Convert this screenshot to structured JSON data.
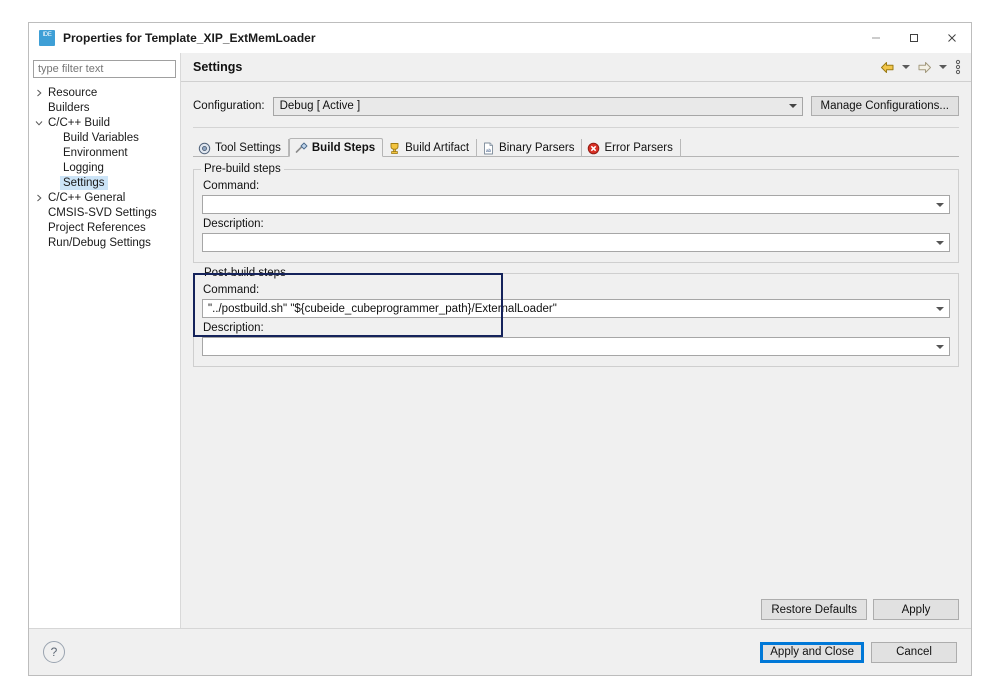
{
  "window": {
    "title": "Properties for Template_XIP_ExtMemLoader",
    "app_icon": "ide-icon",
    "controls": {
      "minimize": "minimize-icon",
      "maximize": "maximize-icon",
      "close": "close-icon"
    }
  },
  "sidebar": {
    "filter": {
      "placeholder": "type filter text",
      "value": ""
    },
    "items": [
      {
        "label": "Resource",
        "indent": 0,
        "twisty": "collapsed",
        "selected": false
      },
      {
        "label": "Builders",
        "indent": 0,
        "twisty": "none",
        "selected": false
      },
      {
        "label": "C/C++ Build",
        "indent": 0,
        "twisty": "expanded",
        "selected": false
      },
      {
        "label": "Build Variables",
        "indent": 1,
        "twisty": "none",
        "selected": false
      },
      {
        "label": "Environment",
        "indent": 1,
        "twisty": "none",
        "selected": false
      },
      {
        "label": "Logging",
        "indent": 1,
        "twisty": "none",
        "selected": false
      },
      {
        "label": "Settings",
        "indent": 1,
        "twisty": "none",
        "selected": true
      },
      {
        "label": "C/C++ General",
        "indent": 0,
        "twisty": "collapsed",
        "selected": false
      },
      {
        "label": "CMSIS-SVD Settings",
        "indent": 0,
        "twisty": "none",
        "selected": false
      },
      {
        "label": "Project References",
        "indent": 0,
        "twisty": "none",
        "selected": false
      },
      {
        "label": "Run/Debug Settings",
        "indent": 0,
        "twisty": "none",
        "selected": false
      }
    ]
  },
  "header": {
    "title": "Settings",
    "tools": [
      {
        "name": "back-arrow-icon",
        "kind": "arrow-left"
      },
      {
        "name": "back-dropdown-icon",
        "kind": "caret"
      },
      {
        "name": "forward-arrow-icon",
        "kind": "arrow-right"
      },
      {
        "name": "forward-dropdown-icon",
        "kind": "caret"
      },
      {
        "name": "view-menu-icon",
        "kind": "kebab"
      }
    ]
  },
  "configuration": {
    "label": "Configuration:",
    "value": "Debug  [ Active ]",
    "manage_button": "Manage Configurations..."
  },
  "tabs": [
    {
      "label": "Tool Settings",
      "icon": "tool-settings-icon",
      "active": false
    },
    {
      "label": "Build Steps",
      "icon": "build-steps-icon",
      "active": true
    },
    {
      "label": "Build Artifact",
      "icon": "build-artifact-icon",
      "active": false
    },
    {
      "label": "Binary Parsers",
      "icon": "binary-parsers-icon",
      "active": false
    },
    {
      "label": "Error Parsers",
      "icon": "error-parsers-icon",
      "active": false
    }
  ],
  "prebuild": {
    "title": "Pre-build steps",
    "command_label": "Command:",
    "command_value": "",
    "description_label": "Description:",
    "description_value": ""
  },
  "postbuild": {
    "title": "Post-build steps",
    "command_label": "Command:",
    "command_value": "\"../postbuild.sh\" \"${cubeide_cubeprogrammer_path}/ExternalLoader\"",
    "description_label": "Description:",
    "description_value": "",
    "highlight_color": "#15235b"
  },
  "page_buttons": {
    "restore_defaults": "Restore Defaults",
    "apply": "Apply"
  },
  "footer": {
    "help": "?",
    "apply_and_close": "Apply and Close",
    "cancel": "Cancel",
    "focus_color": "#0078d7"
  }
}
